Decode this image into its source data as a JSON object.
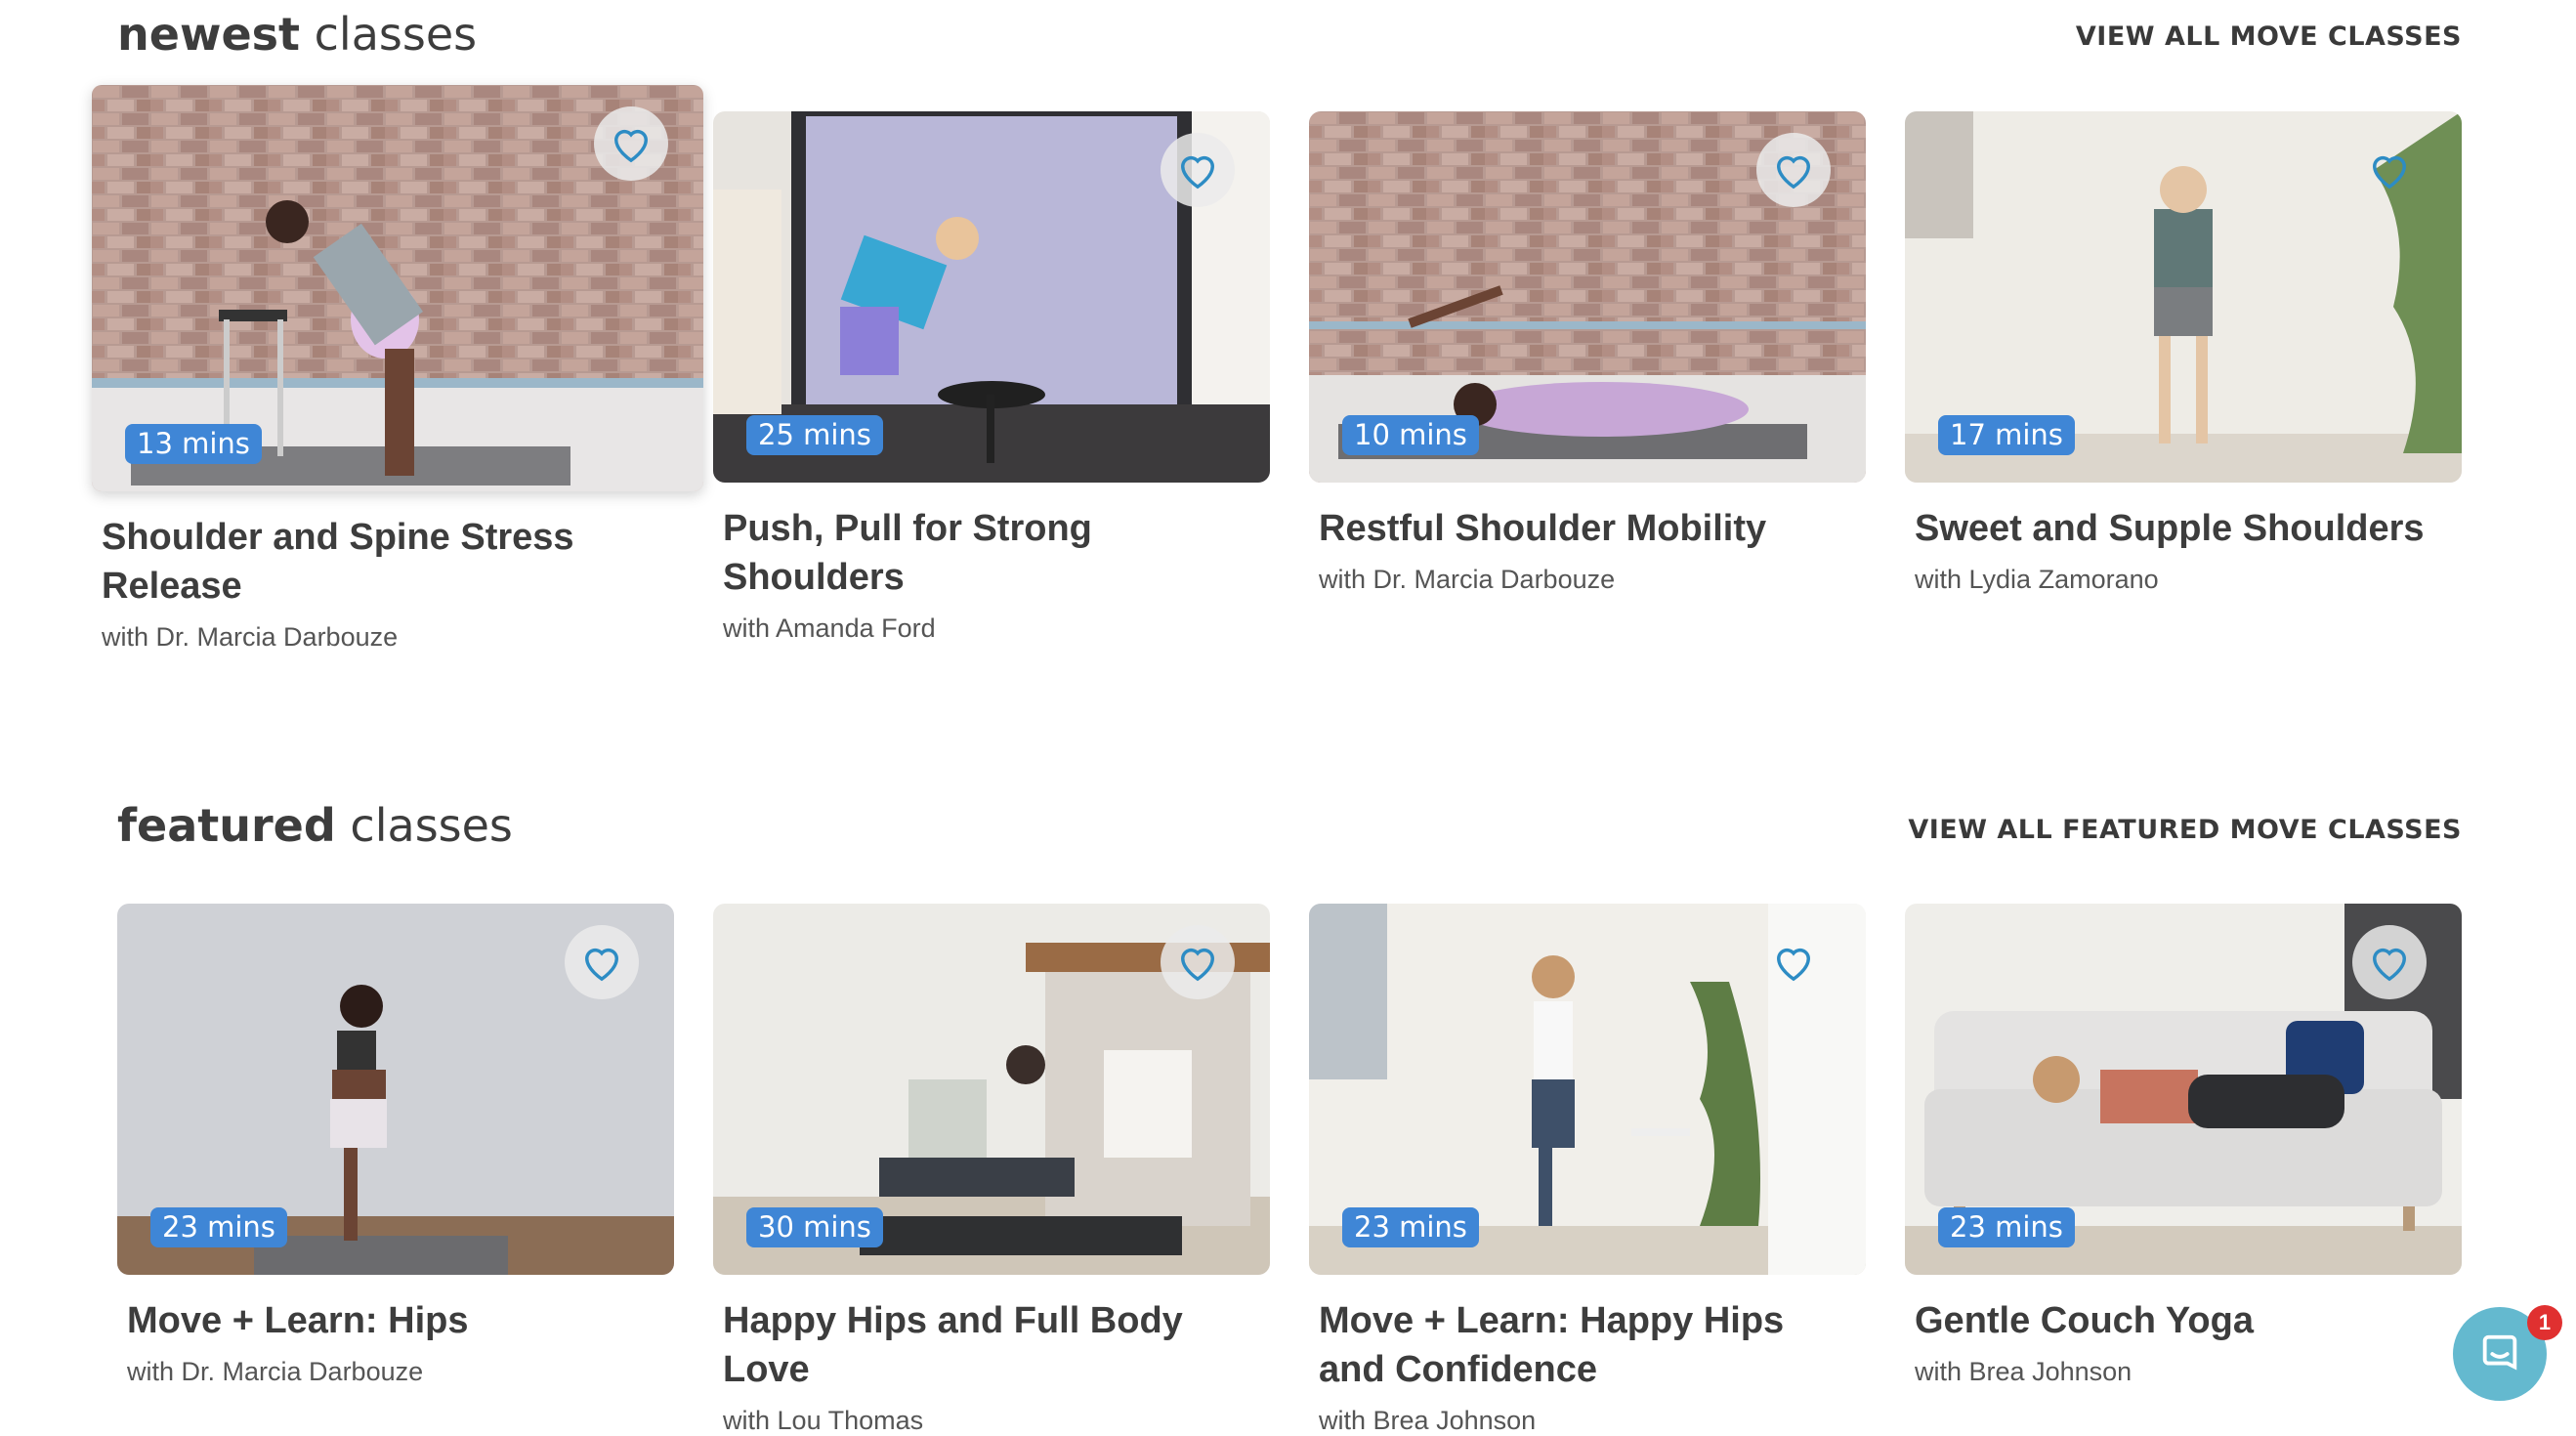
{
  "newest": {
    "title_bold": "newest",
    "title_rest": " classes",
    "view_all": "VIEW ALL MOVE CLASSES",
    "cards": [
      {
        "title": "Shoulder and Spine Stress Release",
        "with": "with",
        "instructor": "Dr. Marcia Darbouze",
        "duration": "13 mins",
        "favorite_icon": "heart-outline-icon"
      },
      {
        "title": "Push, Pull for Strong Shoulders",
        "with": "with",
        "instructor": "Amanda Ford",
        "duration": "25 mins",
        "favorite_icon": "heart-outline-icon"
      },
      {
        "title": "Restful Shoulder Mobility",
        "with": "with",
        "instructor": "Dr. Marcia Darbouze",
        "duration": "10 mins",
        "favorite_icon": "heart-outline-icon"
      },
      {
        "title": "Sweet and Supple Shoulders",
        "with": "with",
        "instructor": "Lydia Zamorano",
        "duration": "17 mins",
        "favorite_icon": "heart-outline-icon"
      }
    ]
  },
  "featured": {
    "title_bold": "featured",
    "title_rest": " classes",
    "view_all": "VIEW ALL FEATURED MOVE CLASSES",
    "cards": [
      {
        "title": "Move + Learn: Hips",
        "with": "with",
        "instructor": "Dr. Marcia Darbouze",
        "duration": "23 mins",
        "favorite_icon": "heart-outline-icon"
      },
      {
        "title": "Happy Hips and Full Body Love",
        "with": "with",
        "instructor": "Lou Thomas",
        "duration": "30 mins",
        "favorite_icon": "heart-outline-icon"
      },
      {
        "title": "Move + Learn: Happy Hips and Confidence",
        "with": "with",
        "instructor": "Brea Johnson",
        "duration": "23 mins",
        "favorite_icon": "heart-outline-icon"
      },
      {
        "title": "Gentle Couch Yoga",
        "with": "with",
        "instructor": "Brea Johnson",
        "duration": "23 mins",
        "favorite_icon": "heart-outline-icon"
      }
    ]
  },
  "chat": {
    "badge_count": "1",
    "icon": "chat-bubble-icon"
  },
  "colors": {
    "accent": "#3f86d6",
    "heart": "#2d8cc4",
    "chat": "#64b9cf",
    "badge": "#e03030"
  }
}
